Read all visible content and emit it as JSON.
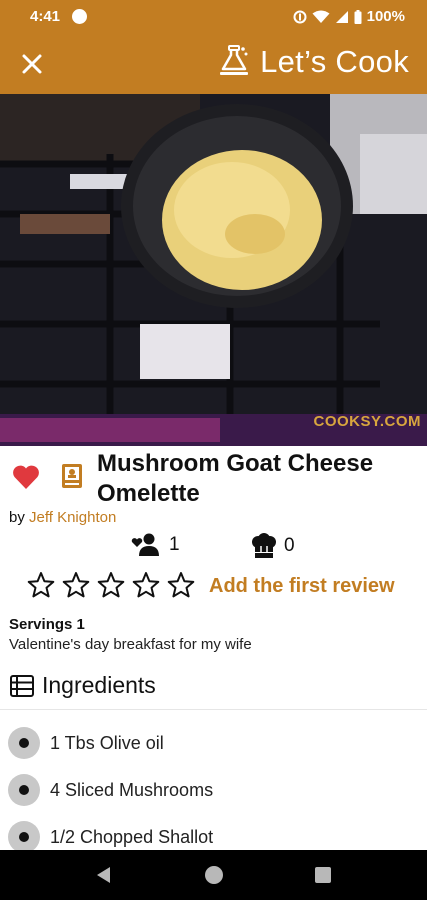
{
  "status_bar": {
    "time": "4:41",
    "battery": "100%"
  },
  "app_bar": {
    "title": "Let’s Cook"
  },
  "hero": {
    "watermark": "COOKSY.COM"
  },
  "recipe": {
    "title": "Mushroom Goat Cheese Omelette",
    "by_prefix": "by ",
    "author": "Jeff Knighton",
    "likes": "1",
    "cooks": "0",
    "rating_stars": 0,
    "review_link": "Add the first review",
    "servings": "Servings 1",
    "description": "Valentine's day breakfast for my wife"
  },
  "ingredients": {
    "title": "Ingredients",
    "items": [
      "1 Tbs Olive oil",
      "4 Sliced Mushrooms",
      "1/2 Chopped Shallot"
    ]
  },
  "colors": {
    "accent": "#c27d22",
    "heart": "#e0393e"
  },
  "icons": {
    "close": "close-icon",
    "cook": "chef-hat-icon",
    "favorite": "heart-icon",
    "cookbook": "cookbook-icon",
    "likes": "user-heart-icon",
    "cooks": "chef-hat-icon",
    "star": "star-outline-icon",
    "ingredients": "list-icon"
  }
}
